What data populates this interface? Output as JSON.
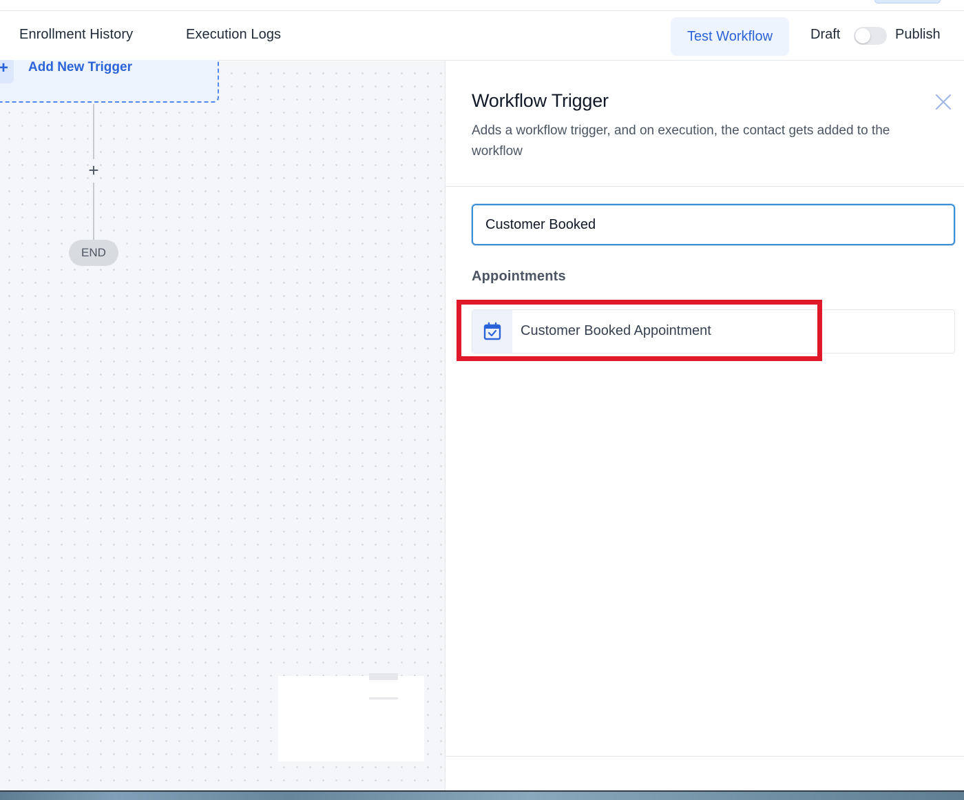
{
  "header": {
    "tabs": [
      {
        "label": "Enrollment History"
      },
      {
        "label": "Execution Logs"
      }
    ],
    "test_button_label": "Test Workflow",
    "draft_label": "Draft",
    "publish_label": "Publish",
    "publish_toggle_on": false
  },
  "canvas": {
    "trigger_label": "Add New Trigger",
    "plus_symbol": "+",
    "end_label": "END"
  },
  "panel": {
    "title": "Workflow Trigger",
    "description": "Adds a workflow trigger, and on execution, the contact gets added to the workflow",
    "search_value": "Customer Booked",
    "section_label": "Appointments",
    "options": [
      {
        "label": "Customer Booked Appointment",
        "icon": "calendar-check-icon"
      }
    ]
  },
  "colors": {
    "accent_blue": "#2b63d9",
    "input_border": "#3b8fd6",
    "highlight_red": "#e0192a"
  }
}
